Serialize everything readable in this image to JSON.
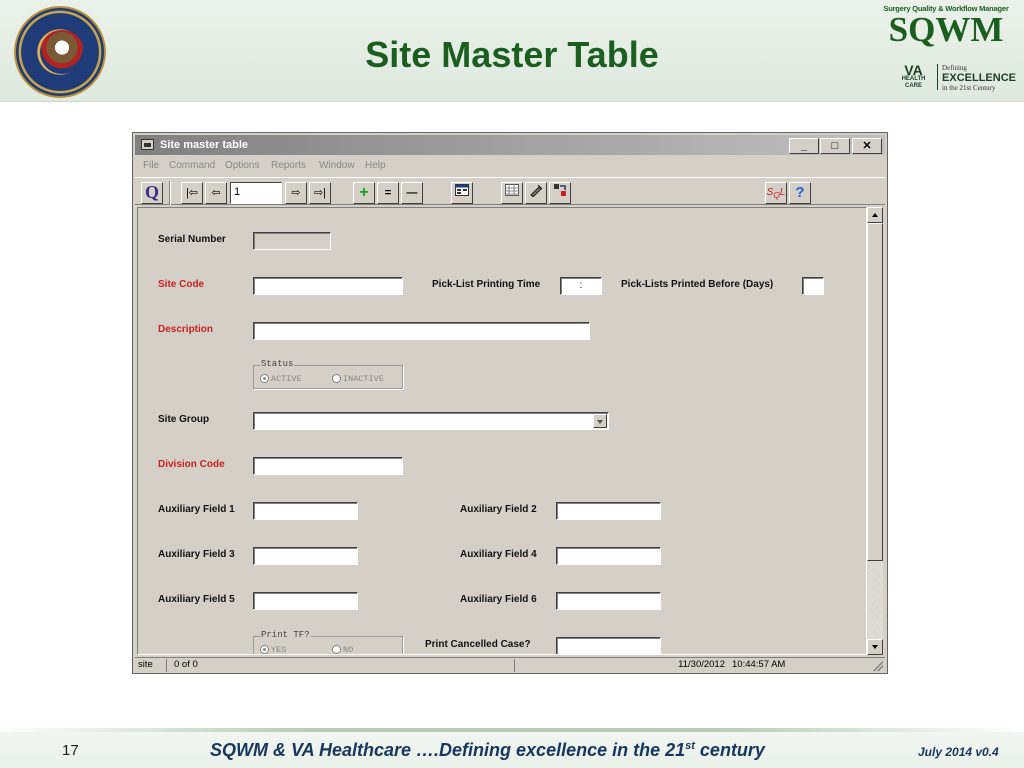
{
  "slide": {
    "title": "Site Master Table",
    "logo": {
      "tagline": "Surgery Quality & Workflow Manager",
      "name": "SQWM",
      "va": "VA",
      "va_sub": "HEALTH CARE",
      "defining": "Defining",
      "excellence": "EXCELLENCE",
      "century": "in the 21st Century"
    },
    "footer": {
      "page_number": "17",
      "text_pre": "SQWM & VA Healthcare ….Defining excellence in the 21",
      "text_sup": "st",
      "text_post": " century",
      "version": "July 2014 v0.4"
    }
  },
  "window": {
    "title": "Site master table",
    "controls": {
      "minimize": "_",
      "maximize": "□",
      "close": "✕"
    },
    "menu": [
      "File",
      "Command",
      "Options",
      "Reports",
      "Window",
      "Help"
    ],
    "toolbar": {
      "query": "Q",
      "first": "|⇦",
      "prev": "⇦",
      "record_number": "1",
      "next": "⇨",
      "last": "⇨|",
      "add": "+",
      "duplicate": "=",
      "delete": "—",
      "icons": [
        "form-view-icon",
        "table-view-icon",
        "edit-pencil-icon",
        "transfer-icon",
        "sql-icon",
        "help-icon"
      ],
      "help": "?"
    },
    "form": {
      "serial_number": {
        "label": "Serial Number",
        "value": ""
      },
      "site_code": {
        "label": "Site Code",
        "value": ""
      },
      "pick_list_time": {
        "label": "Pick-List Printing Time",
        "value": ":"
      },
      "pick_list_days": {
        "label": "Pick-Lists Printed Before (Days)",
        "value": ""
      },
      "description": {
        "label": "Description",
        "value": ""
      },
      "status": {
        "title": "Status",
        "options": [
          "ACTIVE",
          "INACTIVE"
        ],
        "selected": "ACTIVE"
      },
      "site_group": {
        "label": "Site Group",
        "value": ""
      },
      "division_code": {
        "label": "Division Code",
        "value": ""
      },
      "aux1": {
        "label": "Auxiliary Field 1",
        "value": ""
      },
      "aux2": {
        "label": "Auxiliary Field 2",
        "value": ""
      },
      "aux3": {
        "label": "Auxiliary Field 3",
        "value": ""
      },
      "aux4": {
        "label": "Auxiliary Field 4",
        "value": ""
      },
      "aux5": {
        "label": "Auxiliary Field 5",
        "value": ""
      },
      "aux6": {
        "label": "Auxiliary Field 6",
        "value": ""
      },
      "print_tf": {
        "title": "Print TF?",
        "options": [
          "YES",
          "NO"
        ],
        "selected": "YES"
      },
      "print_cancelled": {
        "label": "Print Cancelled Case?",
        "value": ""
      }
    },
    "status_bar": {
      "module": "site",
      "record_count": "0 of 0",
      "date": "11/30/2012",
      "time": "10:44:57 AM"
    },
    "colors": {
      "required_label": "#cc1f1f",
      "title_green": "#1b5e20",
      "footer_blue": "#17375e"
    }
  }
}
